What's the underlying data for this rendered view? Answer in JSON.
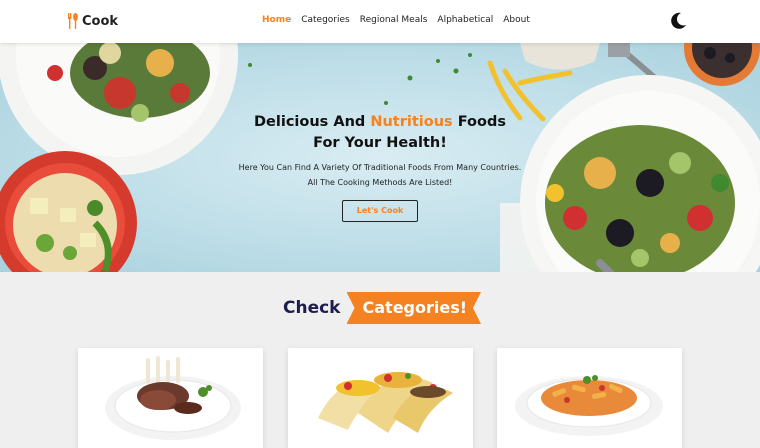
{
  "brand": {
    "name": "Cook",
    "accent": "#f58220"
  },
  "nav": {
    "items": [
      {
        "label": "Home",
        "active": true
      },
      {
        "label": "Categories",
        "active": false
      },
      {
        "label": "Regional Meals",
        "active": false
      },
      {
        "label": "Alphabetical",
        "active": false
      },
      {
        "label": "About",
        "active": false
      }
    ],
    "theme_icon": "moon-icon"
  },
  "hero": {
    "title_part1": "Delicious And ",
    "title_accent": "Nutritious",
    "title_part2": " Foods",
    "title_line2": "For Your Health!",
    "subtitle_line1": "Here You Can Find A Variety Of Traditional Foods From Many Countries.",
    "subtitle_line2": "All The Cooking Methods Are Listed!",
    "button_label": "Let's Cook"
  },
  "categories": {
    "heading_plain": "Check",
    "heading_tag": "Categories!",
    "cards": [
      {
        "image": "lamb-chops-plate"
      },
      {
        "image": "tacos"
      },
      {
        "image": "pasta-plate"
      }
    ]
  }
}
